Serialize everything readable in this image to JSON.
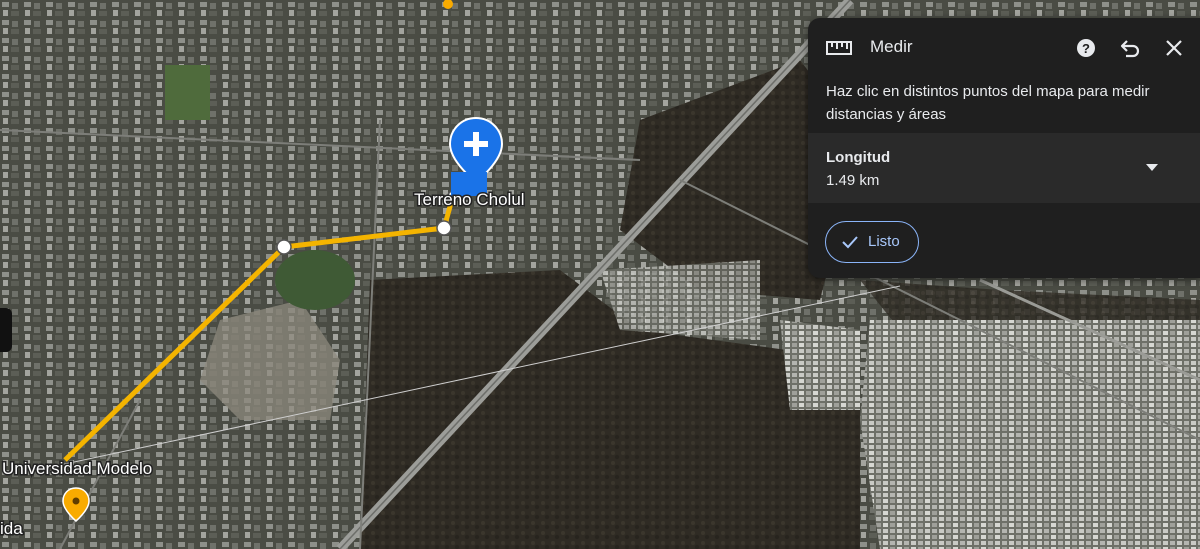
{
  "map": {
    "places": {
      "terreno": "Terreno Cholul",
      "universidad": "Universidad Modelo",
      "partial_left": "ida"
    },
    "colors": {
      "measure_line": "#f4b400",
      "pin_blue": "#1a73e8",
      "pin_yellow": "#f9ab00"
    },
    "icons": {
      "blue_pin": "plus-pin-icon",
      "yellow_pin": "school-pin-icon"
    }
  },
  "measure": {
    "title": "Medir",
    "description": "Haz clic en distintos puntos del mapa para medir distancias y áreas",
    "section_label": "Longitud",
    "distance": "1.49 km",
    "done_label": "Listo",
    "icons": {
      "ruler": "ruler-icon",
      "help": "help-icon",
      "undo": "undo-icon",
      "close": "close-icon",
      "dropdown": "dropdown-arrow-icon",
      "check": "check-icon"
    },
    "accent_color": "#8ab4f8"
  }
}
